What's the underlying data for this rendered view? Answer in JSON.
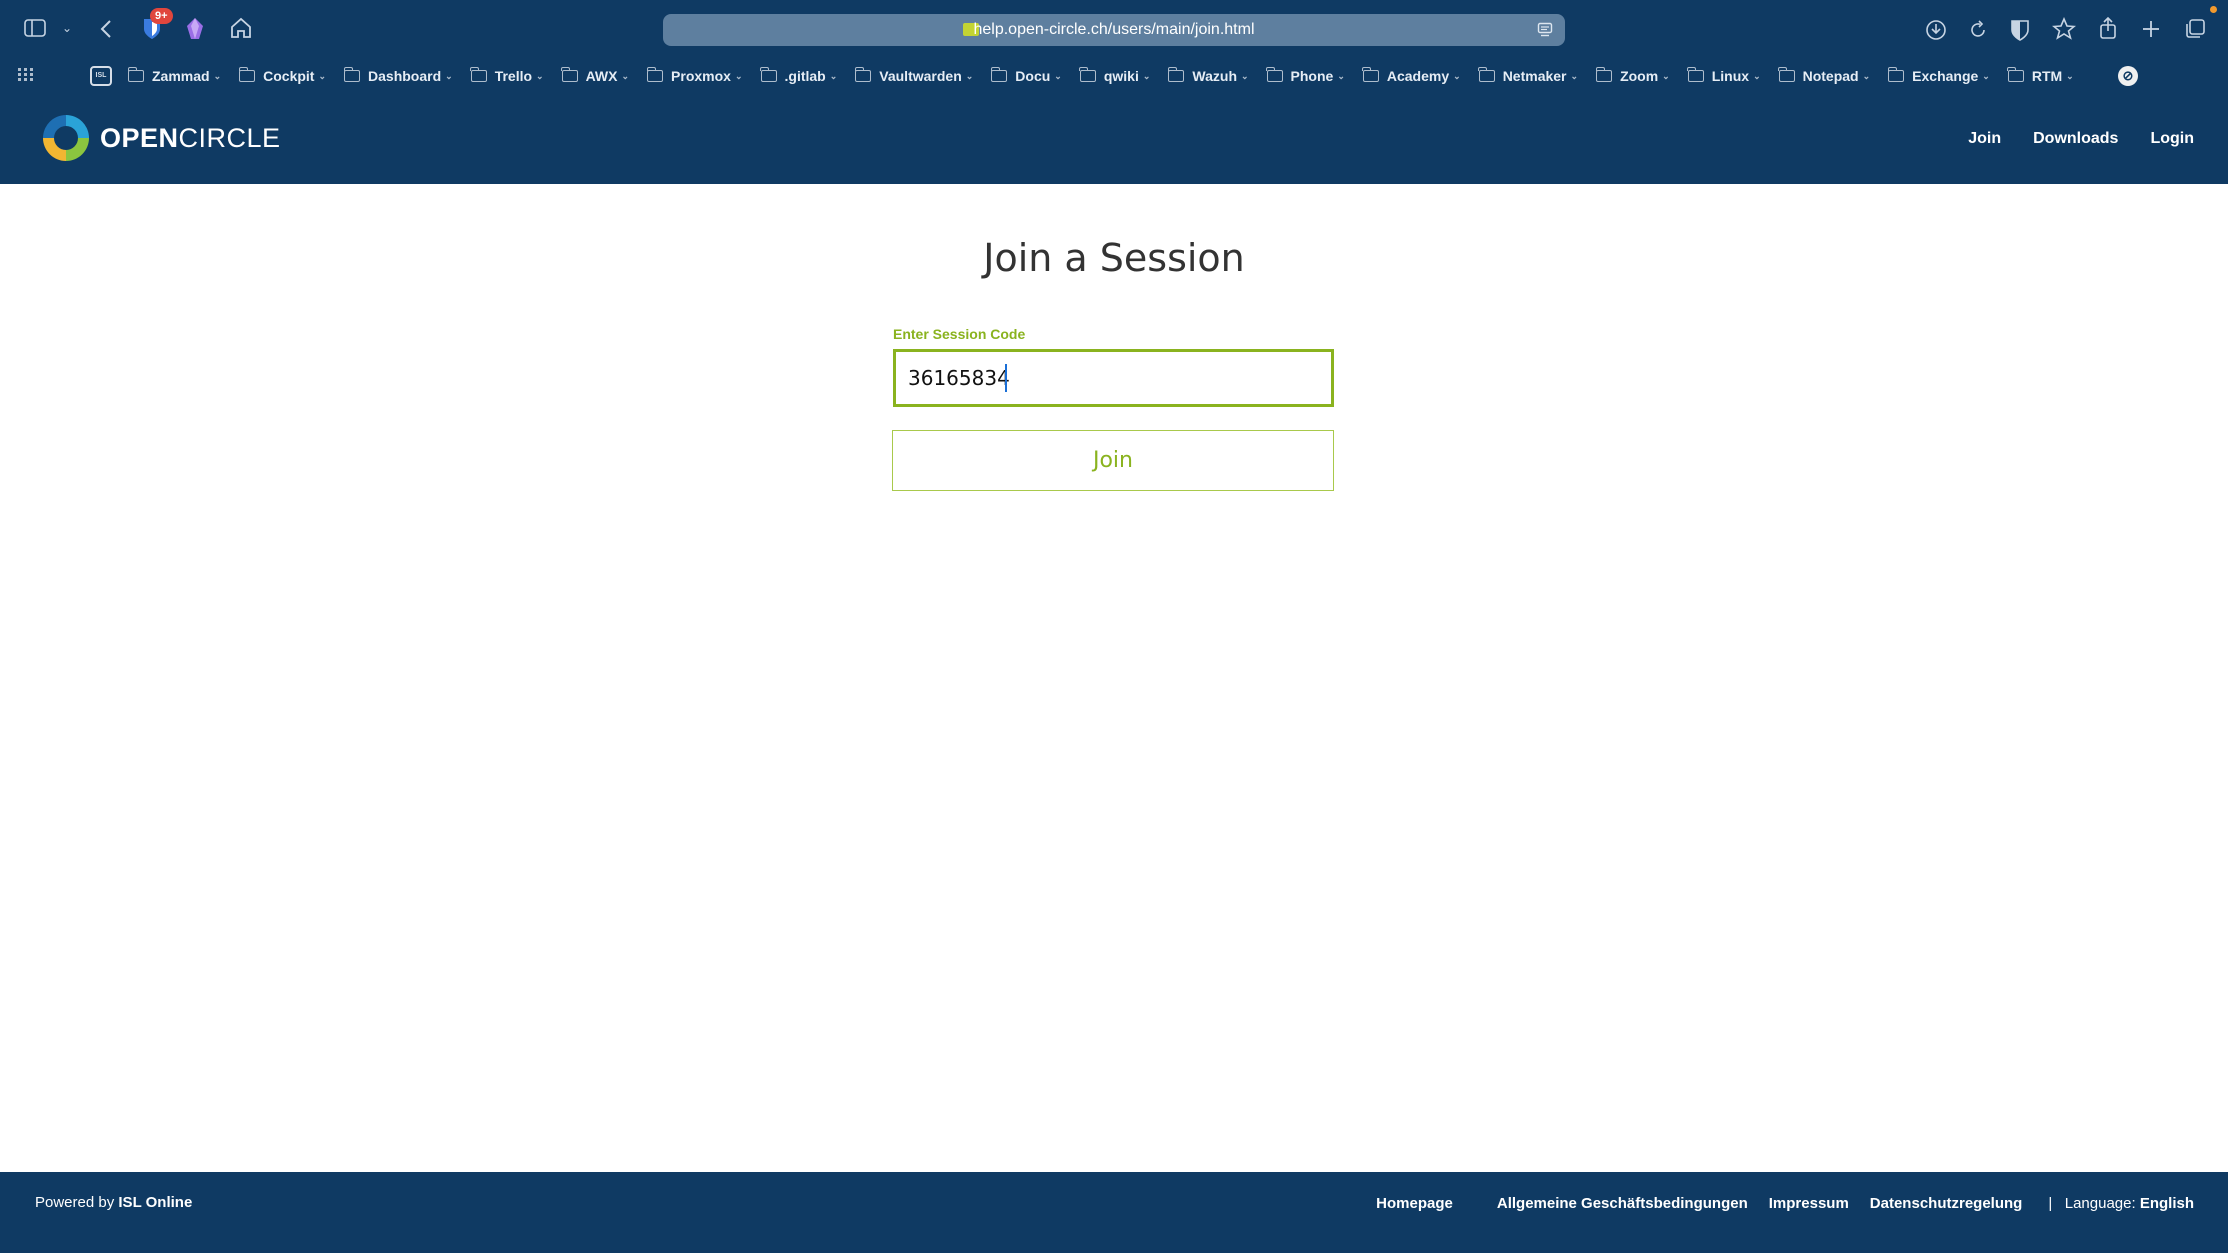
{
  "browser": {
    "url": "help.open-circle.ch/users/main/join.html",
    "notification_badge": "9+",
    "bookmarks": [
      {
        "label": "Zammad"
      },
      {
        "label": "Cockpit"
      },
      {
        "label": "Dashboard"
      },
      {
        "label": "Trello"
      },
      {
        "label": "AWX"
      },
      {
        "label": "Proxmox"
      },
      {
        "label": ".gitlab"
      },
      {
        "label": "Vaultwarden"
      },
      {
        "label": "Docu"
      },
      {
        "label": "qwiki"
      },
      {
        "label": "Wazuh"
      },
      {
        "label": "Phone"
      },
      {
        "label": "Academy"
      },
      {
        "label": "Netmaker"
      },
      {
        "label": "Zoom"
      },
      {
        "label": "Linux"
      },
      {
        "label": "Notepad"
      },
      {
        "label": "Exchange"
      },
      {
        "label": "RTM"
      }
    ],
    "isl_bookmark": "ISL"
  },
  "header": {
    "logo_bold": "OPEN",
    "logo_light": "CIRCLE",
    "nav": {
      "join": "Join",
      "downloads": "Downloads",
      "login": "Login"
    }
  },
  "main": {
    "title": "Join a Session",
    "field_label": "Enter Session Code",
    "session_code": "36165834",
    "join_button": "Join"
  },
  "footer": {
    "powered_prefix": "Powered by",
    "powered_brand": "ISL Online",
    "links": {
      "homepage": "Homepage",
      "terms": "Allgemeine Geschäftsbedingungen",
      "imprint": "Impressum",
      "privacy": "Datenschutzregelung"
    },
    "separator": "|",
    "language_label": "Language:",
    "language_value": "English"
  },
  "colors": {
    "header_bg": "#0f3a63",
    "accent_green": "#8ab31f"
  }
}
